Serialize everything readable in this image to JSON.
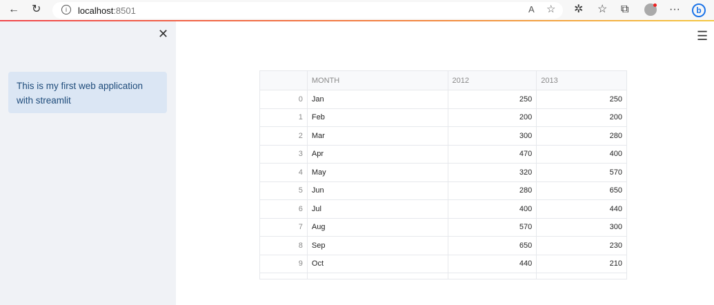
{
  "browser": {
    "host": "localhost",
    "port": ":8501"
  },
  "sidebar": {
    "info_text": "This is my first web application with streamlit"
  },
  "table": {
    "columns": [
      "",
      "MONTH",
      "2012",
      "2013"
    ],
    "rows": [
      [
        "0",
        "Jan",
        "250",
        "250"
      ],
      [
        "1",
        "Feb",
        "200",
        "200"
      ],
      [
        "2",
        "Mar",
        "300",
        "280"
      ],
      [
        "3",
        "Apr",
        "470",
        "400"
      ],
      [
        "4",
        "May",
        "320",
        "570"
      ],
      [
        "5",
        "Jun",
        "280",
        "650"
      ],
      [
        "6",
        "Jul",
        "400",
        "440"
      ],
      [
        "7",
        "Aug",
        "570",
        "300"
      ],
      [
        "8",
        "Sep",
        "650",
        "230"
      ],
      [
        "9",
        "Oct",
        "440",
        "210"
      ],
      [
        "",
        "",
        "",
        ""
      ]
    ]
  }
}
